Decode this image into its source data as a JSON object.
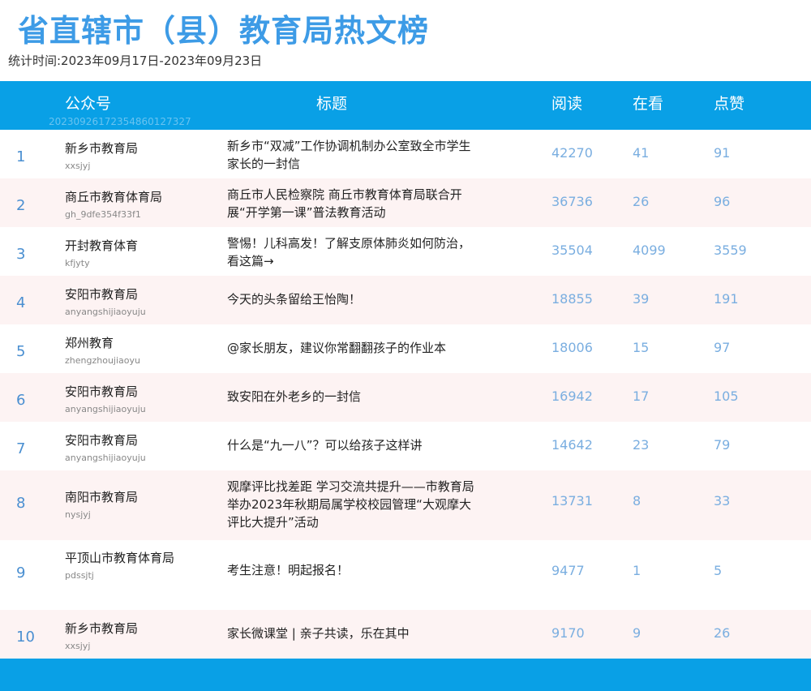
{
  "title": "省直辖市（县）教育局热文榜",
  "period": "统计时间:2023年09月17日-2023年09月23日",
  "header": {
    "account": "公众号",
    "article": "标题",
    "reads": "阅读",
    "watching": "在看",
    "likes": "点赞",
    "stamp": "20230926172354860127327"
  },
  "rows": [
    {
      "rank": "1",
      "name": "新乡市教育局",
      "id": "xxsjyj",
      "article": "新乡市“双减”工作协调机制办公室致全市学生家长的一封信",
      "reads": "42270",
      "watching": "41",
      "likes": "91"
    },
    {
      "rank": "2",
      "name": "商丘市教育体育局",
      "id": "gh_9dfe354f33f1",
      "article": "商丘市人民检察院 商丘市教育体育局联合开展“开学第一课”普法教育活动",
      "reads": "36736",
      "watching": "26",
      "likes": "96"
    },
    {
      "rank": "3",
      "name": "开封教育体育",
      "id": "kfjyty",
      "article": "警惕！儿科高发！了解支原体肺炎如何防治，看这篇→",
      "reads": "35504",
      "watching": "4099",
      "likes": "3559"
    },
    {
      "rank": "4",
      "name": "安阳市教育局",
      "id": "anyangshijiaoyuju",
      "article": "今天的头条留给王怡陶！",
      "reads": "18855",
      "watching": "39",
      "likes": "191"
    },
    {
      "rank": "5",
      "name": "郑州教育",
      "id": "zhengzhoujiaoyu",
      "article": "@家长朋友，建议你常翻翻孩子的作业本",
      "reads": "18006",
      "watching": "15",
      "likes": "97"
    },
    {
      "rank": "6",
      "name": "安阳市教育局",
      "id": "anyangshijiaoyuju",
      "article": "致安阳在外老乡的一封信",
      "reads": "16942",
      "watching": "17",
      "likes": "105"
    },
    {
      "rank": "7",
      "name": "安阳市教育局",
      "id": "anyangshijiaoyuju",
      "article": "什么是“九一八”？可以给孩子这样讲",
      "reads": "14642",
      "watching": "23",
      "likes": "79"
    },
    {
      "rank": "8",
      "name": "南阳市教育局",
      "id": "nysjyj",
      "article": "观摩评比找差距  学习交流共提升——市教育局举办2023年秋期局属学校校园管理“大观摩大评比大提升”活动",
      "reads": "13731",
      "watching": "8",
      "likes": "33"
    },
    {
      "rank": "9",
      "name": "平顶山市教育体育局",
      "id": "pdssjtj",
      "article": "考生注意！明起报名！",
      "reads": "9477",
      "watching": "1",
      "likes": "5"
    },
    {
      "rank": "10",
      "name": "新乡市教育局",
      "id": "xxsjyj",
      "article": "家长微课堂 | 亲子共读，乐在其中",
      "reads": "9170",
      "watching": "9",
      "likes": "26"
    }
  ]
}
